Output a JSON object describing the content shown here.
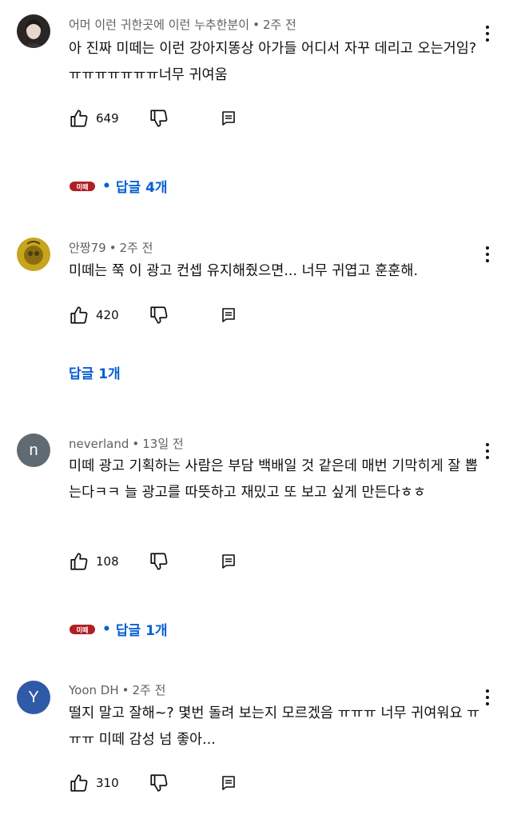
{
  "comments": [
    {
      "author": "어머 이런 귀한곳에 이런 누추한분이",
      "time": "2주 전",
      "text": "아 진짜 미떼는 이런 강아지똥상 아가들 어디서 자꾸 데리고 오는거임?ㅠㅠㅠㅠㅠㅠㅠ너무 귀여움",
      "likes": "649",
      "replies": "답글 4개",
      "creator_heart": true,
      "avatar": {
        "type": "photo",
        "colors": [
          "#2b2626",
          "#e8d6cf"
        ]
      }
    },
    {
      "author": "안짱79",
      "time": "2주 전",
      "text": "미떼는 쭉 이 광고 컨셉 유지해줬으면... 너무 귀엽고 훈훈해.",
      "likes": "420",
      "replies": "답글 1개",
      "creator_heart": false,
      "avatar": {
        "type": "photo",
        "colors": [
          "#c7a51c",
          "#4a3d12"
        ]
      }
    },
    {
      "author": "neverland",
      "time": "13일 전",
      "text": "미떼 광고 기획하는 사람은 부담 백배일 것 같은데 매번 기막히게 잘 뽑는다ㅋㅋ 늘 광고를 따뜻하고 재밌고 또 보고 싶게 만든다ㅎㅎ",
      "likes": "108",
      "replies": "답글 1개",
      "creator_heart": true,
      "avatar": {
        "type": "letter",
        "letter": "n",
        "color": "#5f6a72"
      }
    },
    {
      "author": "Yoon DH",
      "time": "2주 전",
      "text": "떨지 말고 잘해~? 몇번 돌려 보는지 모르겠음 ㅠㅠㅠ 너무 귀여워요 ㅠㅠㅠ  미떼 감성 넘 좋아...",
      "likes": "310",
      "replies": null,
      "creator_heart": false,
      "avatar": {
        "type": "letter",
        "letter": "Y",
        "color": "#2f5aa8"
      }
    }
  ],
  "creator_badge_text": "미떼",
  "colors": {
    "link": "#065fd4",
    "meta": "#606060",
    "creator_red": "#b01f24"
  }
}
